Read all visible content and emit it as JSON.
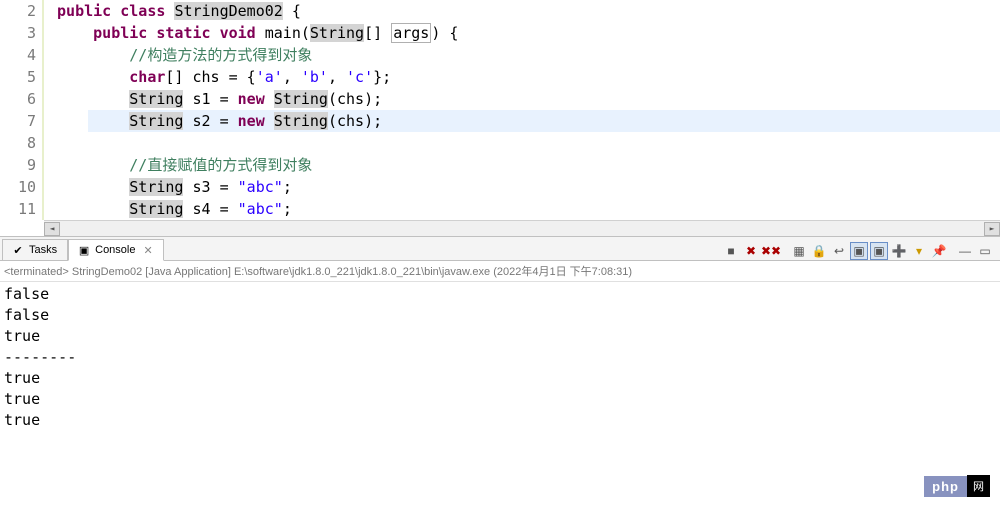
{
  "code": {
    "lineNumbers": [
      "2",
      "3",
      "4",
      "5",
      "6",
      "7",
      "8",
      "9",
      "10",
      "11"
    ],
    "highlightLine": 7,
    "tokens": {
      "l2": {
        "kw1": "public",
        "kw2": "class",
        "cls": "StringDemo02",
        "brace": "{"
      },
      "l3": {
        "kw1": "public",
        "kw2": "static",
        "kw3": "void",
        "fn": "main",
        "p1": "String",
        "p2": "[] ",
        "var": "args",
        "rest": ") {"
      },
      "l4": {
        "comment": "//构造方法的方式得到对象"
      },
      "l5": {
        "kw": "char",
        "decl": "[] chs = {",
        "c1": "'a'",
        "s1": ", ",
        "c2": "'b'",
        "s2": ", ",
        "c3": "'c'",
        "end": "};"
      },
      "l6": {
        "t1": "String",
        "mid": " s1 = ",
        "kw": "new",
        "sp": " ",
        "t2": "String",
        "rest": "(chs);"
      },
      "l7": {
        "t1": "String",
        "mid": " s2 = ",
        "kw": "new",
        "sp": " ",
        "t2": "String",
        "rest": "(chs);"
      },
      "l8": {},
      "l9": {
        "comment": "//直接赋值的方式得到对象"
      },
      "l10": {
        "t1": "String",
        "mid": " s3 = ",
        "str": "\"abc\"",
        "end": ";"
      },
      "l11": {
        "t1": "String",
        "mid": " s4 = ",
        "str": "\"abc\"",
        "end": ";"
      }
    }
  },
  "tabs": {
    "tasks": "Tasks",
    "console": "Console"
  },
  "terminated": {
    "prefix": "<terminated>",
    "name": "StringDemo02 [Java Application]",
    "path": "E:\\software\\jdk1.8.0_221\\jdk1.8.0_221\\bin\\javaw.exe",
    "timestamp": "(2022年4月1日 下午7:08:31)"
  },
  "output": "false\nfalse\ntrue\n--------\ntrue\ntrue\ntrue",
  "watermark": {
    "php": "php",
    "cn": "网"
  }
}
